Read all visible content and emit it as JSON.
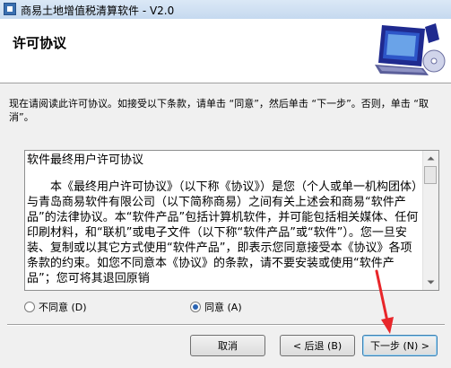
{
  "window": {
    "title": "商易土地增值税清算软件 - V2.0"
  },
  "header": {
    "title": "许可协议"
  },
  "instruction": "现在请阅读此许可协议。如接受以下条款，请单击 “同意”，然后单击 “下一步”。否则，单击 “取消”。",
  "license": {
    "heading": "软件最终用户许可协议",
    "paragraph": "本《最终用户许可协议》（以下称《协议》）是您（个人或单一机构团体）与青岛商易软件有限公司（以下简称商易）之间有关上述会和商易“软件产品”的法律协议。本“软件产品”包括计算机软件，并可能包括相关媒体、任何印刷材料，和“联机”或电子文件（以下称“软件产品”或“软件”）。您一旦安装、复制或以其它方式使用“软件产品”，即表示您同意接受本《协议》各项条款的约束。如您不同意本《协议》的条款，请不要安装或使用“软件产品”；您可将其退回原销"
  },
  "options": {
    "disagree": "不同意 (D)",
    "agree": "同意 (A)",
    "selected": "agree"
  },
  "buttons": {
    "cancel": "取消",
    "back": "< 后退 (B)",
    "next": "下一步 (N) >"
  },
  "colors": {
    "annotation_arrow": "#e8262a",
    "radio_dot": "#2a64b3"
  }
}
